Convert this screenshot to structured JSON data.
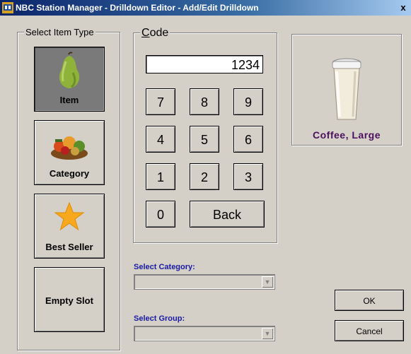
{
  "window": {
    "title": "NBC Station Manager - Drilldown Editor - Add/Edit Drilldown",
    "close_glyph": "x"
  },
  "item_type": {
    "group_label": "Select Item Type",
    "options": [
      {
        "label": "Item",
        "icon": "pear-icon",
        "selected": true
      },
      {
        "label": "Category",
        "icon": "food-basket-icon",
        "selected": false
      },
      {
        "label": "Best Seller",
        "icon": "star-icon",
        "selected": false
      },
      {
        "label": "Empty Slot",
        "icon": "",
        "selected": false
      }
    ]
  },
  "code": {
    "group_label": "Code",
    "value": "1234",
    "keys": [
      "7",
      "8",
      "9",
      "4",
      "5",
      "6",
      "1",
      "2",
      "3",
      "0"
    ],
    "back_label": "Back"
  },
  "preview": {
    "name": "Coffee, Large",
    "icon": "coffee-cup-icon",
    "label_color": "#4b0f5e"
  },
  "select_category": {
    "label": "Select Category:",
    "value": ""
  },
  "select_group": {
    "label": "Select Group:",
    "value": ""
  },
  "buttons": {
    "ok": "OK",
    "cancel": "Cancel"
  }
}
